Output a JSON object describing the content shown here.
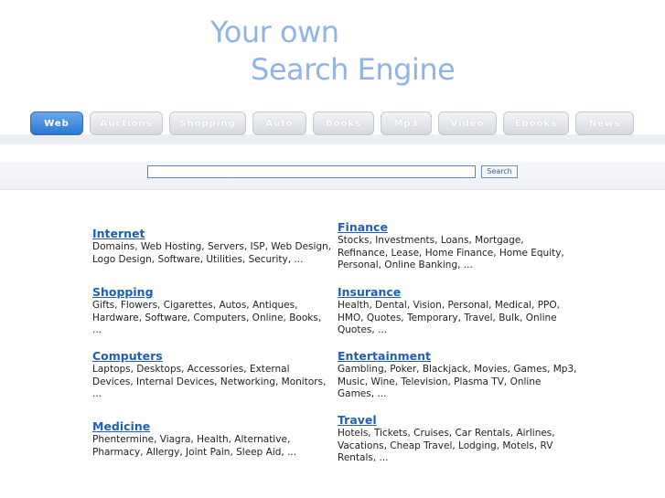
{
  "logo": {
    "line1": "Your own",
    "line2": "Search Engine"
  },
  "tabs": [
    {
      "label": "Web",
      "active": true
    },
    {
      "label": "Auctions",
      "active": false
    },
    {
      "label": "Shopping",
      "active": false
    },
    {
      "label": "Auto",
      "active": false
    },
    {
      "label": "Books",
      "active": false
    },
    {
      "label": "Mp3",
      "active": false
    },
    {
      "label": "Video",
      "active": false
    },
    {
      "label": "Ebooks",
      "active": false
    },
    {
      "label": "News",
      "active": false
    }
  ],
  "search": {
    "value": "",
    "button_label": "Search"
  },
  "categories": {
    "left": [
      {
        "title": "Internet",
        "desc": "Domains, Web Hosting, Servers, ISP, Web Design, Logo Design, Software, Utilities, Security,  ..."
      },
      {
        "title": "Shopping",
        "desc": "Gifts, Flowers, Cigarettes, Autos, Antiques, Hardware, Software, Computers, Online, Books,  ..."
      },
      {
        "title": "Computers",
        "desc": "Laptops, Desktops, Accessories, External Devices, Internal Devices, Networking, Monitors,  ..."
      },
      {
        "title": "Medicine",
        "desc": "Phentermine, Viagra, Health, Alternative, Pharmacy, Allergy, Joint Pain, Sleep Aid,  ..."
      }
    ],
    "right": [
      {
        "title": "Finance",
        "desc": "Stocks, Investments, Loans, Mortgage, Refinance, Lease, Home Finance, Home Equity, Personal, Online Banking,  ..."
      },
      {
        "title": "Insurance",
        "desc": "Health, Dental, Vision, Personal, Medical, PPO, HMO, Quotes, Temporary, Travel, Bulk, Online Quotes,  ..."
      },
      {
        "title": "Entertainment",
        "desc": "Gambling, Poker, Blackjack, Movies, Games, Mp3, Music, Wine, Television, Plasma TV, Online Games,  ..."
      },
      {
        "title": "Travel",
        "desc": "Hotels, Tickets, Cruises, Car Rentals, Airlines, Vacations, Cheap Travel, Lodging, Motels, RV Rentals,  ..."
      }
    ]
  }
}
